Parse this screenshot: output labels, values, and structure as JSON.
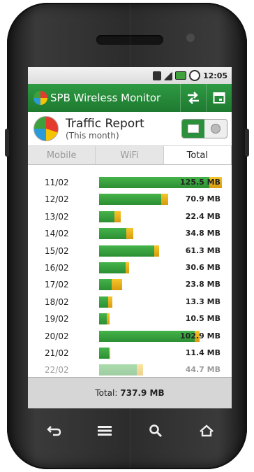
{
  "status_bar": {
    "time": "12:05"
  },
  "app": {
    "title": "SPB Wireless Monitor"
  },
  "header": {
    "title": "Traffic Report",
    "subtitle": "(This month)"
  },
  "tabs": [
    {
      "label": "Mobile",
      "active": false
    },
    {
      "label": "WiFi",
      "active": false
    },
    {
      "label": "Total",
      "active": true
    }
  ],
  "rows": [
    {
      "date": "11/02",
      "value": "125.5 MB",
      "mb": 125.5,
      "yellow": 0.1
    },
    {
      "date": "12/02",
      "value": "70.9 MB",
      "mb": 70.9,
      "yellow": 0.1
    },
    {
      "date": "13/02",
      "value": "22.4 MB",
      "mb": 22.4,
      "yellow": 0.3
    },
    {
      "date": "14/02",
      "value": "34.8 MB",
      "mb": 34.8,
      "yellow": 0.2
    },
    {
      "date": "15/02",
      "value": "61.3 MB",
      "mb": 61.3,
      "yellow": 0.08
    },
    {
      "date": "16/02",
      "value": "30.6 MB",
      "mb": 30.6,
      "yellow": 0.12
    },
    {
      "date": "17/02",
      "value": "23.8 MB",
      "mb": 23.8,
      "yellow": 0.45
    },
    {
      "date": "18/02",
      "value": "13.3 MB",
      "mb": 13.3,
      "yellow": 0.3
    },
    {
      "date": "19/02",
      "value": "10.5 MB",
      "mb": 10.5,
      "yellow": 0.3
    },
    {
      "date": "20/02",
      "value": "102.9 MB",
      "mb": 102.9,
      "yellow": 0.05
    },
    {
      "date": "21/02",
      "value": "11.4 MB",
      "mb": 11.4,
      "yellow": 0.15
    },
    {
      "date": "22/02",
      "value": "44.7 MB",
      "mb": 44.7,
      "yellow": 0.15
    }
  ],
  "scale_max_mb": 125.5,
  "footer": {
    "label": "Total:",
    "value": "737.9 MB"
  },
  "colors": {
    "green": "#2c8f33",
    "yellow": "#e5ad18",
    "titlebar": "#1e7a30"
  },
  "icons": {
    "titlebar": [
      "sync-arrows-icon",
      "calendar-icon"
    ],
    "nav": [
      "back-icon",
      "menu-icon",
      "search-icon",
      "home-icon"
    ]
  }
}
